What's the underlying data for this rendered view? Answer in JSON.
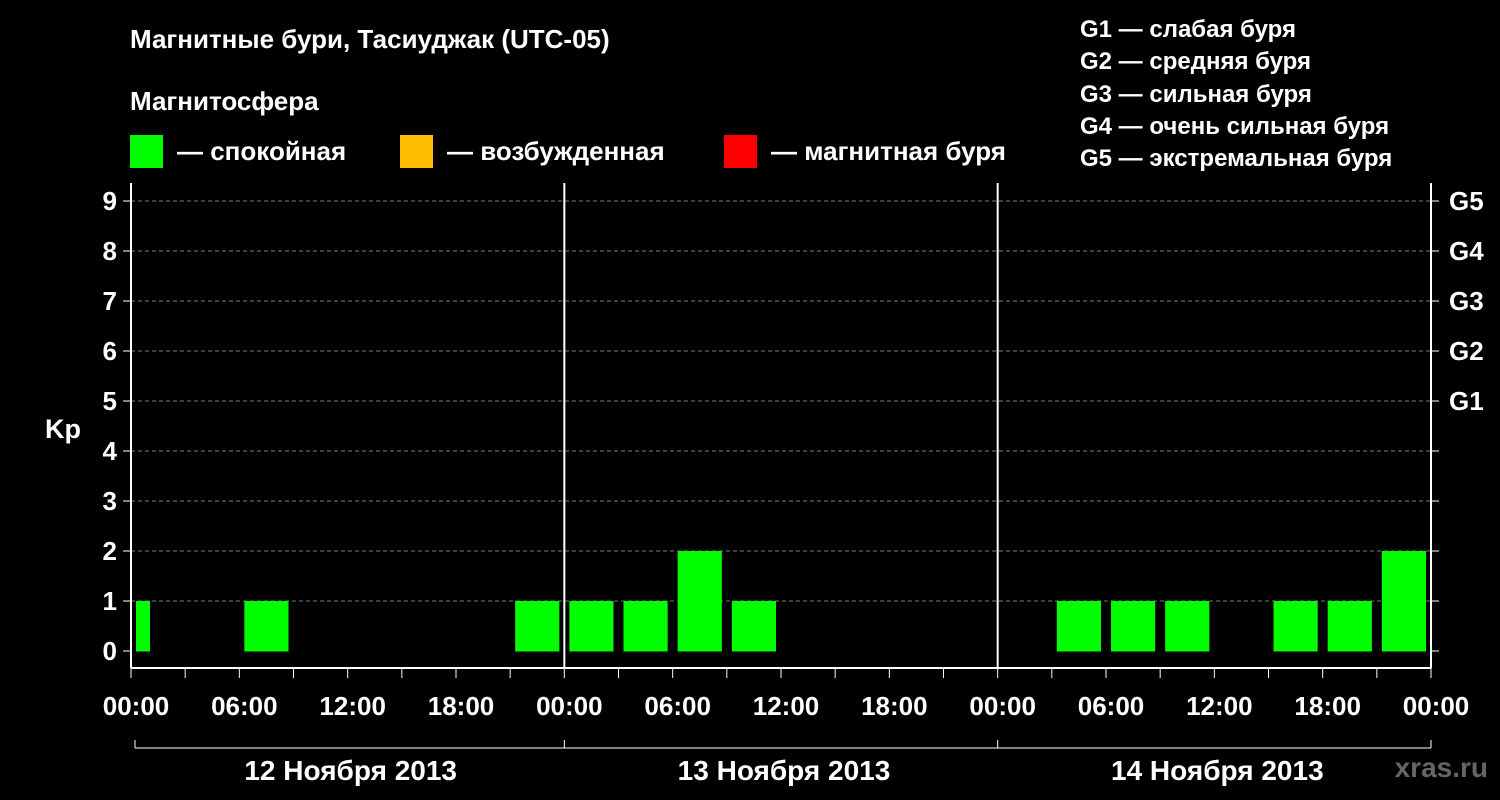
{
  "title": "Магнитные бури, Тасиуджак (UTC-05)",
  "subtitle": "Магнитосфера",
  "legend": [
    {
      "color": "#00ff00",
      "label": "— спокойная"
    },
    {
      "color": "#ffbf00",
      "label": "— возбужденная"
    },
    {
      "color": "#ff0000",
      "label": "— магнитная буря"
    }
  ],
  "g_legend": [
    "G1 — слабая буря",
    "G2 — средняя буря",
    "G3 — сильная буря",
    "G4 — очень сильная буря",
    "G5 — экстремальная буря"
  ],
  "watermark": "xras.ru",
  "chart_data": {
    "type": "bar",
    "ylabel": "Kp",
    "ylim": [
      0,
      9
    ],
    "yticks": [
      0,
      1,
      2,
      3,
      4,
      5,
      6,
      7,
      8,
      9
    ],
    "g_ticks": [
      {
        "kp": 5,
        "label": "G1"
      },
      {
        "kp": 6,
        "label": "G2"
      },
      {
        "kp": 7,
        "label": "G3"
      },
      {
        "kp": 8,
        "label": "G4"
      },
      {
        "kp": 9,
        "label": "G5"
      }
    ],
    "x_tick_labels": [
      "00:00",
      "06:00",
      "12:00",
      "18:00",
      "00:00",
      "06:00",
      "12:00",
      "18:00",
      "00:00",
      "06:00",
      "12:00",
      "18:00",
      "00:00"
    ],
    "days": [
      "12 Ноября 2013",
      "13 Ноября 2013",
      "14 Ноября 2013"
    ],
    "bar_color": "#00ff00",
    "grid": "dashed horizontal",
    "categories": [
      "12.11 00-03",
      "12.11 03-06",
      "12.11 06-09",
      "12.11 09-12",
      "12.11 12-15",
      "12.11 15-18",
      "12.11 18-21",
      "12.11 21-24",
      "13.11 00-03",
      "13.11 03-06",
      "13.11 06-09",
      "13.11 09-12",
      "13.11 12-15",
      "13.11 15-18",
      "13.11 18-21",
      "13.11 21-24",
      "14.11 00-03",
      "14.11 03-06",
      "14.11 06-09",
      "14.11 09-12",
      "14.11 12-15",
      "14.11 15-18",
      "14.11 18-21",
      "14.11 21-24"
    ],
    "values": [
      1,
      0,
      1,
      0,
      0,
      0,
      0,
      1,
      1,
      1,
      2,
      1,
      0,
      0,
      0,
      0,
      0,
      1,
      1,
      1,
      0,
      1,
      1,
      2
    ]
  }
}
